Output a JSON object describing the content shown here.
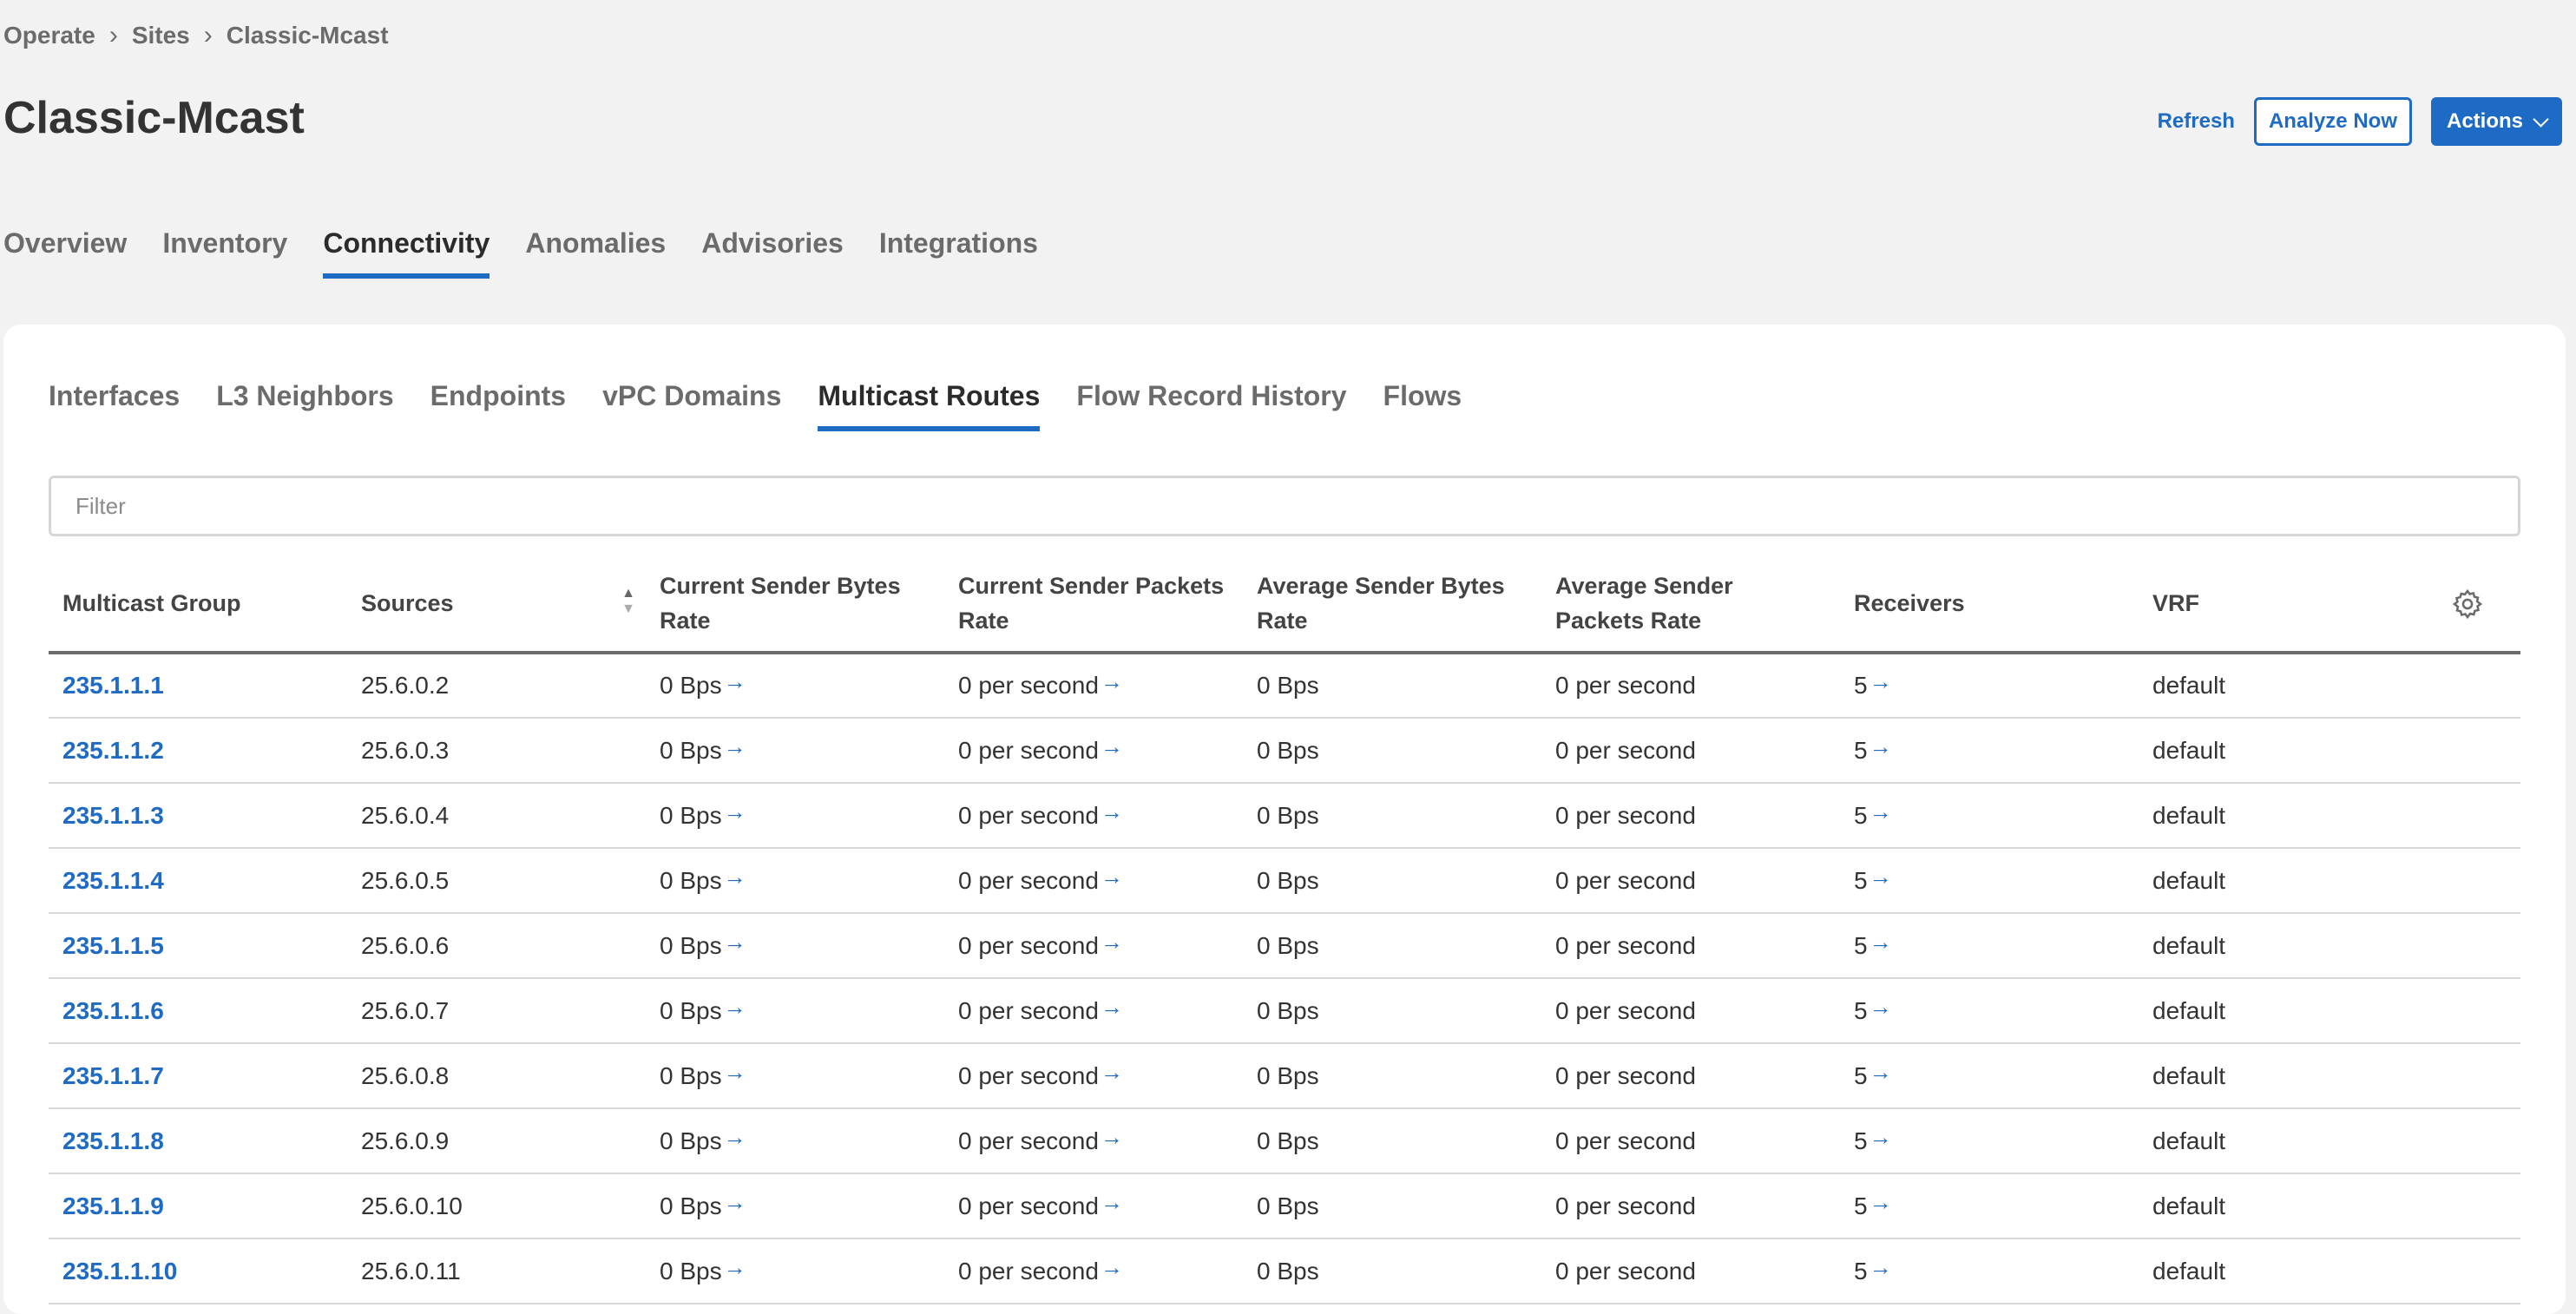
{
  "breadcrumb": [
    "Operate",
    "Sites",
    "Classic-Mcast"
  ],
  "breadcrumb_sep": "›",
  "page_title": "Classic-Mcast",
  "actions": {
    "refresh": "Refresh",
    "analyze": "Analyze Now",
    "actions": "Actions"
  },
  "main_tabs": [
    "Overview",
    "Inventory",
    "Connectivity",
    "Anomalies",
    "Advisories",
    "Integrations"
  ],
  "main_tab_active": "Connectivity",
  "sub_tabs": [
    "Interfaces",
    "L3 Neighbors",
    "Endpoints",
    "vPC Domains",
    "Multicast Routes",
    "Flow Record History",
    "Flows"
  ],
  "sub_tab_active": "Multicast Routes",
  "filter": {
    "placeholder": "Filter",
    "value": ""
  },
  "sort_glyphs": {
    "up": "▲",
    "down": "▼"
  },
  "table": {
    "columns": [
      "Multicast Group",
      "Sources",
      "Current Sender Bytes Rate",
      "Current Sender Packets Rate",
      "Average Sender Bytes Rate",
      "Average Sender Packets Rate",
      "Receivers",
      "VRF"
    ],
    "arrow_glyph": "→",
    "rows": [
      [
        "235.1.1.1",
        "25.6.0.2",
        "0 Bps",
        "0 per second",
        "0 Bps",
        "0 per second",
        "5",
        "default"
      ],
      [
        "235.1.1.2",
        "25.6.0.3",
        "0 Bps",
        "0 per second",
        "0 Bps",
        "0 per second",
        "5",
        "default"
      ],
      [
        "235.1.1.3",
        "25.6.0.4",
        "0 Bps",
        "0 per second",
        "0 Bps",
        "0 per second",
        "5",
        "default"
      ],
      [
        "235.1.1.4",
        "25.6.0.5",
        "0 Bps",
        "0 per second",
        "0 Bps",
        "0 per second",
        "5",
        "default"
      ],
      [
        "235.1.1.5",
        "25.6.0.6",
        "0 Bps",
        "0 per second",
        "0 Bps",
        "0 per second",
        "5",
        "default"
      ],
      [
        "235.1.1.6",
        "25.6.0.7",
        "0 Bps",
        "0 per second",
        "0 Bps",
        "0 per second",
        "5",
        "default"
      ],
      [
        "235.1.1.7",
        "25.6.0.8",
        "0 Bps",
        "0 per second",
        "0 Bps",
        "0 per second",
        "5",
        "default"
      ],
      [
        "235.1.1.8",
        "25.6.0.9",
        "0 Bps",
        "0 per second",
        "0 Bps",
        "0 per second",
        "5",
        "default"
      ],
      [
        "235.1.1.9",
        "25.6.0.10",
        "0 Bps",
        "0 per second",
        "0 Bps",
        "0 per second",
        "5",
        "default"
      ],
      [
        "235.1.1.10",
        "25.6.0.11",
        "0 Bps",
        "0 per second",
        "0 Bps",
        "0 per second",
        "5",
        "default"
      ]
    ]
  },
  "colors": {
    "accent": "#1e6bc5",
    "background": "#f2f2f2"
  }
}
